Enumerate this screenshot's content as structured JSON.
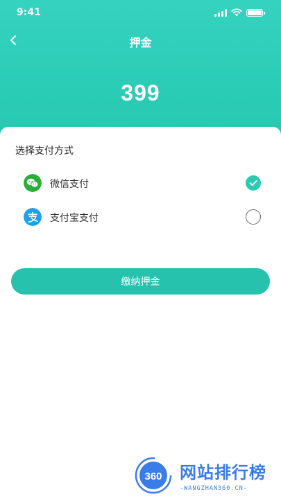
{
  "status_bar": {
    "time": "9:41"
  },
  "nav": {
    "title": "押金"
  },
  "deposit": {
    "amount": "399"
  },
  "payment": {
    "section_title": "选择支付方式",
    "methods": [
      {
        "label": "微信支付",
        "icon": "wechat-icon",
        "selected": true,
        "color": "#2aae3b"
      },
      {
        "label": "支付宝支付",
        "icon": "alipay-icon",
        "selected": false,
        "color": "#1da1e8"
      }
    ]
  },
  "submit": {
    "label": "缴纳押金"
  },
  "watermark": {
    "brand": "网站排行榜",
    "site": "-WANGZHAN360.CN-",
    "logo_text": "360"
  },
  "colors": {
    "accent": "#27c2ad",
    "header": "#2ccdb7"
  }
}
